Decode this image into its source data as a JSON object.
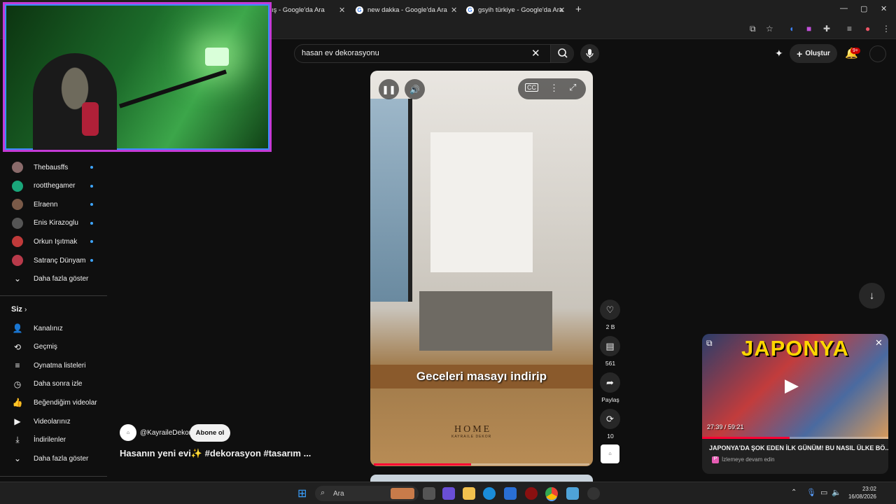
{
  "browser": {
    "tabs": [
      {
        "title": "ış - Google'da Ara"
      },
      {
        "title": "new dakka - Google'da Ara"
      },
      {
        "title": "gsyih türkiye - Google'da Ara"
      }
    ],
    "new_tab": "+",
    "window_buttons": [
      "—",
      "▢",
      "✕"
    ]
  },
  "youtube": {
    "search": {
      "query": "hasan ev dekorasyonu"
    },
    "create_label": "Oluştur",
    "notification_count": "9+",
    "sidebar": {
      "subscriptions": [
        {
          "name": "Thebausffs",
          "color": "#8a6a6a"
        },
        {
          "name": "rootthegamer",
          "color": "#1aa67a"
        },
        {
          "name": "Elraenn",
          "color": "#7a5a48"
        },
        {
          "name": "Enis Kirazoglu",
          "color": "#555555"
        },
        {
          "name": "Orkun Işıtmak",
          "color": "#c03a3a"
        },
        {
          "name": "Satranç Dünyam",
          "color": "#b83a4a"
        }
      ],
      "show_more": "Daha fazla göster",
      "you_heading": "Siz",
      "you_items": [
        {
          "label": "Kanalınız",
          "icon": "channel-icon"
        },
        {
          "label": "Geçmiş",
          "icon": "history-icon"
        },
        {
          "label": "Oynatma listeleri",
          "icon": "playlist-icon"
        },
        {
          "label": "Daha sonra izle",
          "icon": "clock-icon"
        },
        {
          "label": "Beğendiğim videolar",
          "icon": "thumb-up-icon"
        },
        {
          "label": "Videolarınız",
          "icon": "video-icon"
        },
        {
          "label": "İndirilenler",
          "icon": "download-icon"
        },
        {
          "label": "Daha fazla göster",
          "icon": "chevron-down-icon"
        }
      ]
    },
    "short": {
      "subtitle": "Geceleri masayı indirip",
      "watermark": "HOME",
      "watermark_sub": "KAYRAILE DEKOR",
      "progress": 0.45,
      "channel": "@KayraileDekor",
      "subscribe_label": "Abone ol",
      "title": "Hasanın yeni evi✨ #dekorasyon #tasarım ...",
      "likes": "2 B",
      "comments": "561",
      "share_label": "Paylaş",
      "remix_count": "10"
    },
    "miniplayer": {
      "thumb_text": "JAPONYA",
      "time": "27:39 / 59:21",
      "progress": 0.47,
      "title": "JAPONYA'DA ŞOK EDEN İLK GÜNÜM! BU NASIL ÜLKE BÖ...",
      "continue_label": "İzlemeye devam edin"
    }
  },
  "taskbar": {
    "search_placeholder": "Ara",
    "time": "23:02",
    "date": "16/08/2026"
  }
}
